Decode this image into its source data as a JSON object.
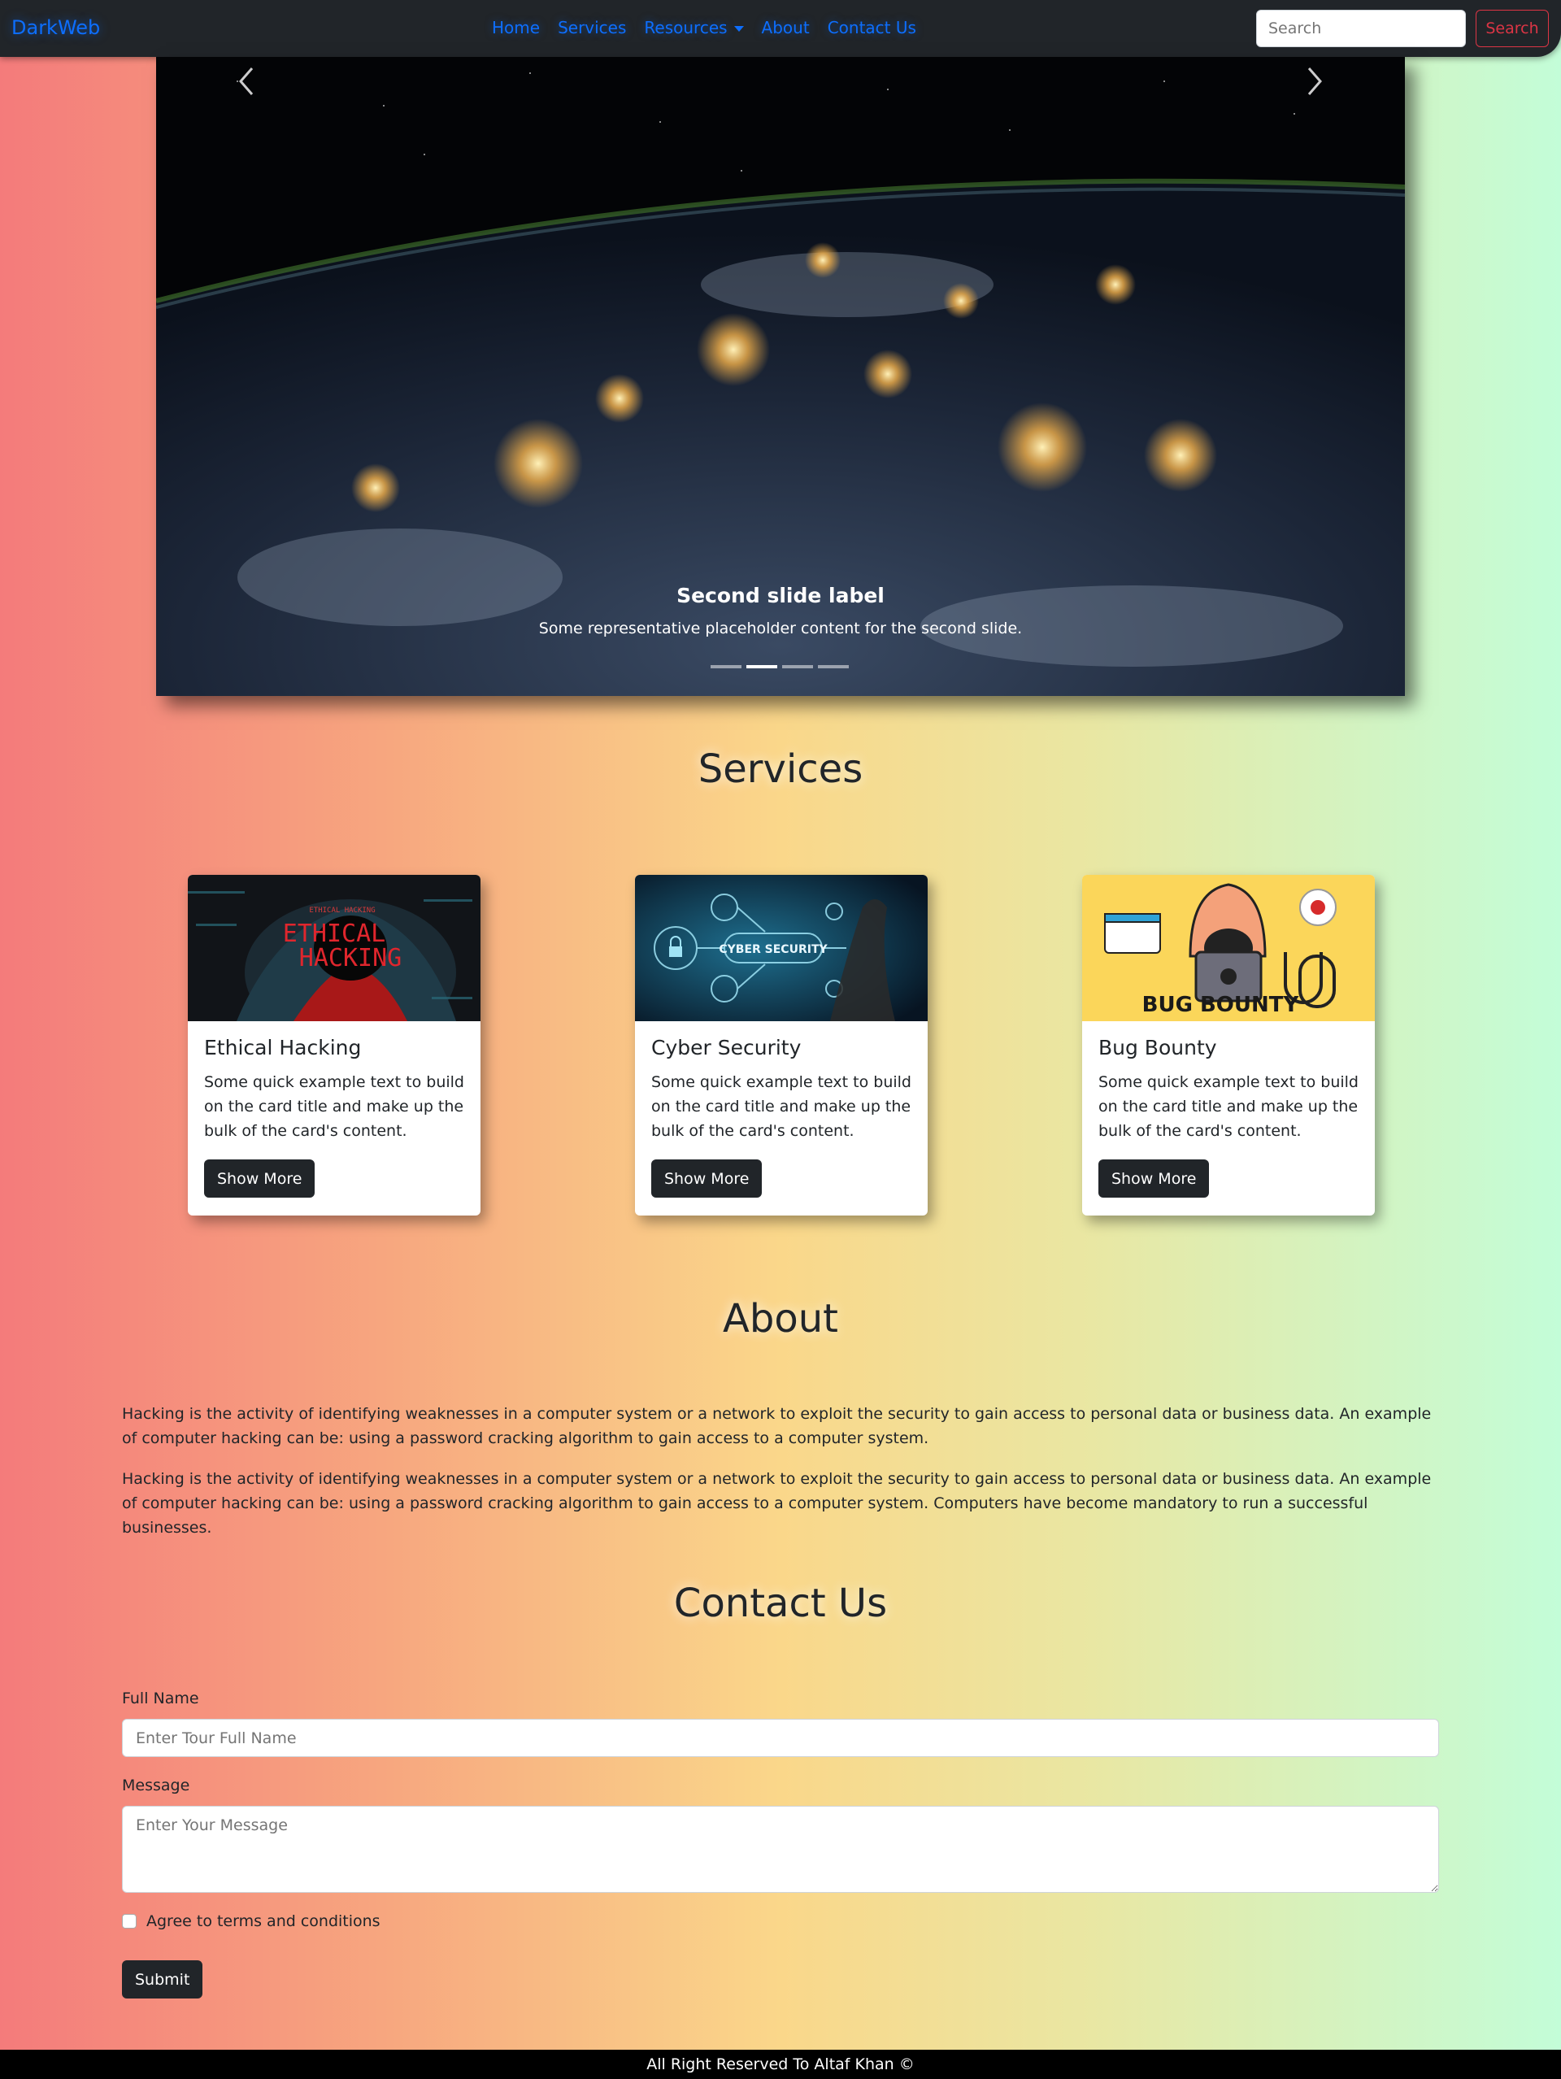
{
  "navbar": {
    "brand": "DarkWeb",
    "links": [
      "Home",
      "Services",
      "Resources",
      "About",
      "Contact Us"
    ],
    "search_placeholder": "Search",
    "search_button": "Search",
    "brand_color": "#0d6efd",
    "search_button_color": "#dc3545"
  },
  "carousel": {
    "caption_title": "Second slide label",
    "caption_text": "Some representative placeholder content for the second slide.",
    "prev_icon": "chevron-left-icon",
    "next_icon": "chevron-right-icon",
    "indicator_count": 4,
    "active_indicator": 2
  },
  "services": {
    "title": "Services",
    "cards": [
      {
        "title": "Ethical Hacking",
        "text": "Some quick example text to build on the card title and make up the bulk of the card's content.",
        "button": "Show More",
        "image_text": [
          "ETHICAL HACKING",
          "ETHICAL",
          "HACKING"
        ]
      },
      {
        "title": "Cyber Security",
        "text": "Some quick example text to build on the card title and make up the bulk of the card's content.",
        "button": "Show More",
        "image_text": [
          "CYBER SECURITY"
        ]
      },
      {
        "title": "Bug Bounty",
        "text": "Some quick example text to build on the card title and make up the bulk of the card's content.",
        "button": "Show More",
        "image_text": [
          "BUG BOUNTY"
        ]
      }
    ]
  },
  "about": {
    "title": "About",
    "paragraphs": [
      "Hacking is the activity of identifying weaknesses in a computer system or a network to exploit the security to gain access to personal data or business data. An example of computer hacking can be: using a password cracking algorithm to gain access to a computer system.",
      "Hacking is the activity of identifying weaknesses in a computer system or a network to exploit the security to gain access to personal data or business data. An example of computer hacking can be: using a password cracking algorithm to gain access to a computer system. Computers have become mandatory to run a successful businesses."
    ]
  },
  "contact": {
    "title": "Contact Us",
    "name_label": "Full Name",
    "name_placeholder": "Enter Tour Full Name",
    "message_label": "Message",
    "message_placeholder": "Enter Your Message",
    "checkbox_label": "Agree to terms and conditions",
    "submit": "Submit"
  },
  "footer": {
    "text": "All Right Reserved To Altaf Khan ©"
  }
}
